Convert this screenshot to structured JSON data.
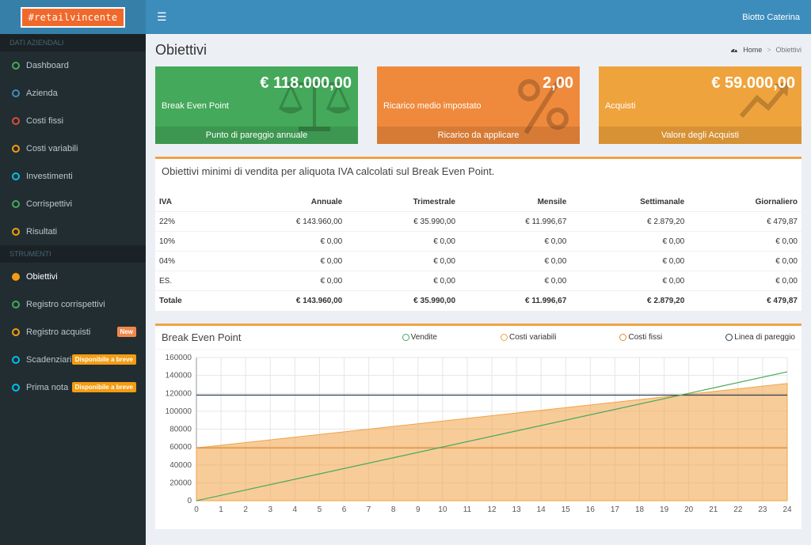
{
  "logo": "#retailvincente",
  "topbar": {
    "menu_icon": "hamburger-icon",
    "user": "Biotto Caterina"
  },
  "sidebar": {
    "section1": "DATI AZIENDALI",
    "items1": [
      {
        "label": "Dashboard",
        "color": "#44a95a"
      },
      {
        "label": "Azienda",
        "color": "#3c8dbc"
      },
      {
        "label": "Costi fissi",
        "color": "#dd4b39"
      },
      {
        "label": "Costi variabili",
        "color": "#f39c12"
      },
      {
        "label": "Investimenti",
        "color": "#00c0ef"
      },
      {
        "label": "Corrispettivi",
        "color": "#44a95a"
      },
      {
        "label": "Risultati",
        "color": "#f39c12"
      }
    ],
    "section2": "STRUMENTI",
    "items2": [
      {
        "label": "Obiettivi",
        "color": "#f39c12",
        "filled": true
      },
      {
        "label": "Registro corrispettivi",
        "color": "#44a95a"
      },
      {
        "label": "Registro acquisti",
        "color": "#f39c12",
        "badge": "New"
      },
      {
        "label": "Scadenziario",
        "color": "#00c0ef",
        "badge": "Disponibile a breve"
      },
      {
        "label": "Prima nota",
        "color": "#00c0ef",
        "badge": "Disponibile a breve"
      }
    ]
  },
  "page": {
    "title": "Obiettivi",
    "breadcrumb_home": "Home",
    "breadcrumb_current": "Obiettivi"
  },
  "boxes": [
    {
      "value": "€ 118.000,00",
      "label": "Break Even Point",
      "footer": "Punto di pareggio annuale",
      "icon": "balance-scale-icon"
    },
    {
      "value": "2,00",
      "label": "Ricarico medio impostato",
      "footer": "Ricarico da applicare",
      "icon": "percent-icon"
    },
    {
      "value": "€ 59.000,00",
      "label": "Acquisti",
      "footer": "Valore degli Acquisti",
      "icon": "trend-up-icon"
    }
  ],
  "table_panel": {
    "title": "Obiettivi minimi di vendita per aliquota IVA calcolati sul Break Even Point.",
    "headers": [
      "IVA",
      "Annuale",
      "Trimestrale",
      "Mensile",
      "Settimanale",
      "Giornaliero"
    ],
    "rows": [
      [
        "22%",
        "€ 143.960,00",
        "€ 35.990,00",
        "€ 11.996,67",
        "€ 2.879,20",
        "€ 479,87"
      ],
      [
        "10%",
        "€ 0,00",
        "€ 0,00",
        "€ 0,00",
        "€ 0,00",
        "€ 0,00"
      ],
      [
        "04%",
        "€ 0,00",
        "€ 0,00",
        "€ 0,00",
        "€ 0,00",
        "€ 0,00"
      ],
      [
        "ES.",
        "€ 0,00",
        "€ 0,00",
        "€ 0,00",
        "€ 0,00",
        "€ 0,00"
      ],
      [
        "Totale",
        "€ 143.960,00",
        "€ 35.990,00",
        "€ 11.996,67",
        "€ 2.879,20",
        "€ 479,87"
      ]
    ]
  },
  "chart_data": {
    "type": "line",
    "title": "Break Even Point",
    "x": [
      0,
      1,
      2,
      3,
      4,
      5,
      6,
      7,
      8,
      9,
      10,
      11,
      12,
      13,
      14,
      15,
      16,
      17,
      18,
      19,
      20,
      21,
      22,
      23,
      24
    ],
    "xlim": [
      0,
      24
    ],
    "ylim": [
      0,
      160000
    ],
    "yticks": [
      0,
      20000,
      40000,
      60000,
      80000,
      100000,
      120000,
      140000,
      160000
    ],
    "grid": true,
    "legend_position": "top-right",
    "series": [
      {
        "name": "Vendite",
        "color": "#44a95a",
        "start": 0,
        "end": 144000
      },
      {
        "name": "Costi variabili",
        "color": "#f0a346",
        "start": 59000,
        "end": 131000,
        "fill": true
      },
      {
        "name": "Costi fissi",
        "color": "#e38a35",
        "start": 59000,
        "end": 59000
      },
      {
        "name": "Linea di pareggio",
        "color": "#2c3e50",
        "start": 118000,
        "end": 118000
      }
    ]
  }
}
